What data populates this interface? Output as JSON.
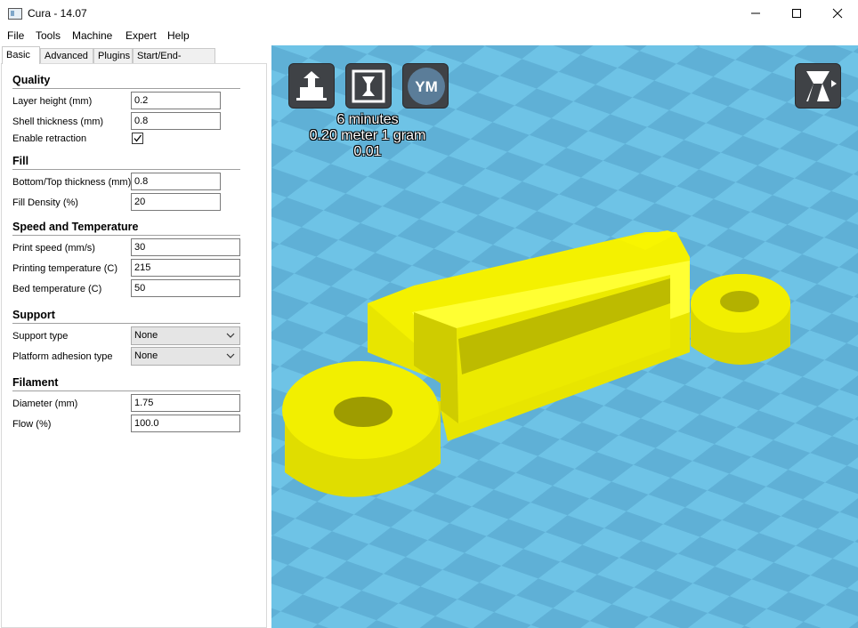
{
  "window": {
    "title": "Cura - 14.07"
  },
  "menu": [
    "File",
    "Tools",
    "Machine",
    "Expert",
    "Help"
  ],
  "tabs": [
    "Basic",
    "Advanced",
    "Plugins",
    "Start/End-GCode"
  ],
  "sections": {
    "quality": {
      "title": "Quality",
      "layer_height": {
        "label": "Layer height (mm)",
        "value": "0.2"
      },
      "shell_thickness": {
        "label": "Shell thickness (mm)",
        "value": "0.8"
      },
      "enable_retraction": {
        "label": "Enable retraction",
        "checked": true
      }
    },
    "fill": {
      "title": "Fill",
      "bottom_top_thickness": {
        "label": "Bottom/Top thickness (mm)",
        "value": "0.8"
      },
      "fill_density": {
        "label": "Fill Density (%)",
        "value": "20"
      }
    },
    "speed": {
      "title": "Speed and Temperature",
      "print_speed": {
        "label": "Print speed (mm/s)",
        "value": "30"
      },
      "printing_temperature": {
        "label": "Printing temperature (C)",
        "value": "215"
      },
      "bed_temperature": {
        "label": "Bed temperature (C)",
        "value": "50"
      }
    },
    "support": {
      "title": "Support",
      "support_type": {
        "label": "Support type",
        "value": "None"
      },
      "platform_adhesion": {
        "label": "Platform adhesion type",
        "value": "None"
      }
    },
    "filament": {
      "title": "Filament",
      "diameter": {
        "label": "Diameter (mm)",
        "value": "1.75"
      },
      "flow": {
        "label": "Flow (%)",
        "value": "100.0"
      }
    }
  },
  "viewport": {
    "toolbar": {
      "icons": [
        "load-model-icon",
        "print-icon",
        "youmagine-icon",
        "view-mode-icon"
      ],
      "youmagine_label": "YM"
    },
    "stats": {
      "time": "6 minutes",
      "material": "0.20 meter 1 gram",
      "cost": "0.01"
    },
    "colors": {
      "model": "#f1ee00",
      "floor_light": "#6ec3e6",
      "floor_dark": "#5eabcf"
    }
  }
}
